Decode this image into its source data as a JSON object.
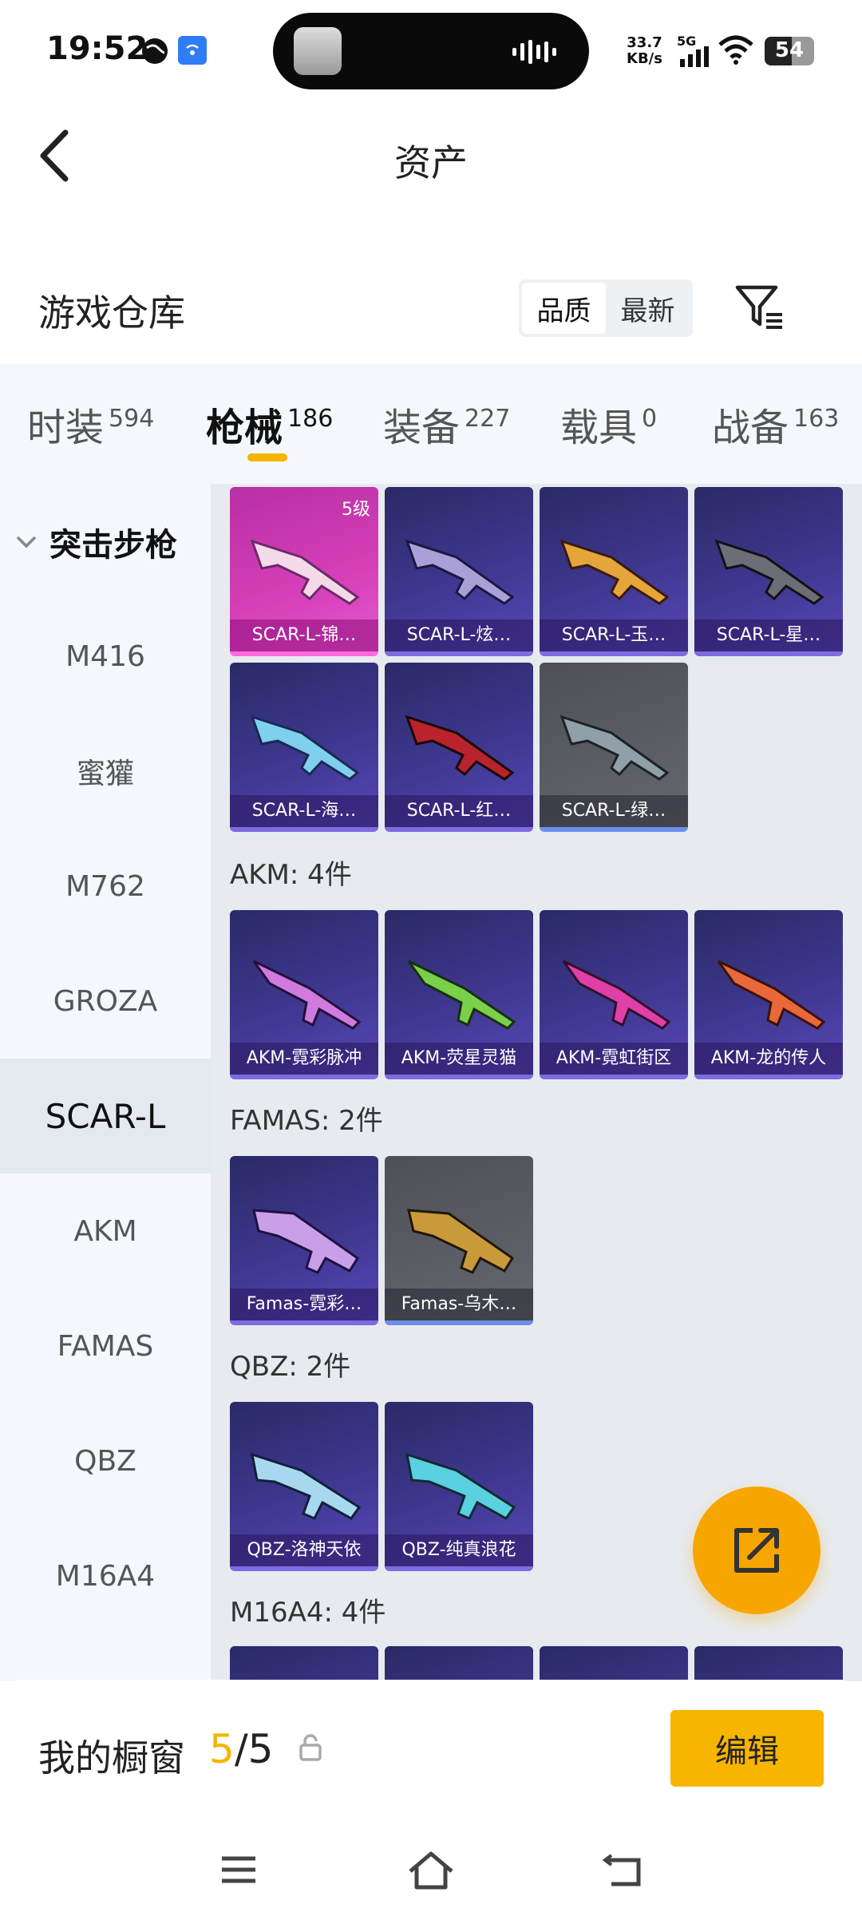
{
  "status_bar": {
    "time": "19:52",
    "net_speed_top": "33.7",
    "net_speed_bottom": "KB/s",
    "network": "5G",
    "battery": "54"
  },
  "header": {
    "title": "资产"
  },
  "warehouse": {
    "title": "游戏仓库",
    "sort_options": [
      "品质",
      "最新"
    ],
    "active_sort": "品质"
  },
  "tabs": [
    {
      "label": "时装",
      "count": "594"
    },
    {
      "label": "枪械",
      "count": "186"
    },
    {
      "label": "装备",
      "count": "227"
    },
    {
      "label": "载具",
      "count": "0"
    },
    {
      "label": "战备",
      "count": "163"
    }
  ],
  "active_tab": "枪械",
  "sidebar": {
    "category": "突击步枪",
    "items": [
      "M416",
      "蜜獾",
      "M762",
      "GROZA",
      "SCAR-L",
      "AKM",
      "FAMAS",
      "QBZ",
      "M16A4"
    ],
    "active": "SCAR-L"
  },
  "groups": {
    "scar": {
      "items": [
        {
          "name": "SCAR-L-锦…",
          "level": "5级",
          "style": "pink"
        },
        {
          "name": "SCAR-L-炫…",
          "style": "purple"
        },
        {
          "name": "SCAR-L-玉…",
          "style": "purple"
        },
        {
          "name": "SCAR-L-星…",
          "style": "purple"
        },
        {
          "name": "SCAR-L-海…",
          "style": "purple"
        },
        {
          "name": "SCAR-L-红…",
          "style": "purple"
        },
        {
          "name": "SCAR-L-绿…",
          "style": "gray"
        }
      ]
    },
    "akm": {
      "title": "AKM: 4件",
      "items": [
        "AKM-霓彩脉冲",
        "AKM-荧星灵猫",
        "AKM-霓虹街区",
        "AKM-龙的传人"
      ]
    },
    "famas": {
      "title": "FAMAS: 2件",
      "items": [
        "Famas-霓彩…",
        "Famas-乌木…"
      ]
    },
    "qbz": {
      "title": "QBZ: 2件",
      "items": [
        "QBZ-洛神天依",
        "QBZ-纯真浪花"
      ]
    },
    "m16": {
      "title": "M16A4: 4件"
    }
  },
  "showcase": {
    "label": "我的橱窗",
    "current": "5",
    "separator": "/",
    "max": "5",
    "edit_label": "编辑"
  },
  "colors": {
    "accent": "#f5b400",
    "card_purple": "#3f3790",
    "card_pink": "#d63fb8",
    "card_gray": "#5c5e66"
  }
}
